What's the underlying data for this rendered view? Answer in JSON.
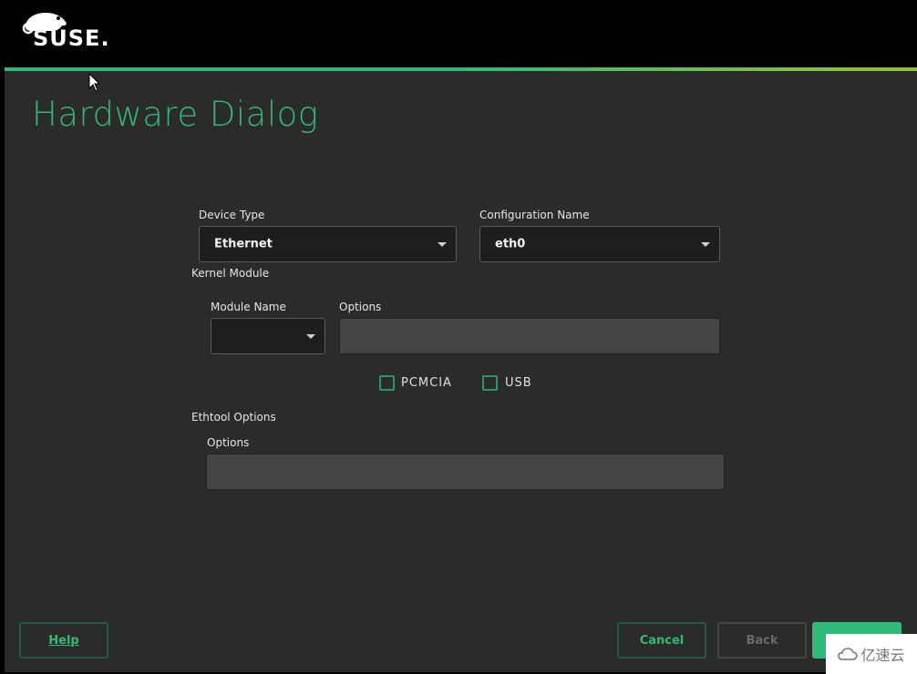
{
  "header": {
    "brand": "SUSE.",
    "brand_color": "#30ba78"
  },
  "page": {
    "title": "Hardware Dialog"
  },
  "device_type": {
    "label": "Device Type",
    "mnemonic": "D",
    "value": "Ethernet"
  },
  "configuration_name": {
    "label": "Configuration Name",
    "value": "eth0"
  },
  "kernel_module": {
    "section_label": "Kernel Module",
    "module_name_label": "Module Name",
    "module_name_value": "",
    "options_label": "Options",
    "options_value": "",
    "checkboxes": [
      {
        "label": "PCMCIA",
        "checked": false
      },
      {
        "label": "USB",
        "checked": false
      }
    ]
  },
  "ethtool": {
    "section_label": "Ethtool Options",
    "options_label": "Options",
    "options_value": ""
  },
  "buttons": {
    "help": "Help",
    "cancel": "Cancel",
    "back": "Back",
    "next": ""
  },
  "watermark": {
    "text": "亿速云"
  }
}
